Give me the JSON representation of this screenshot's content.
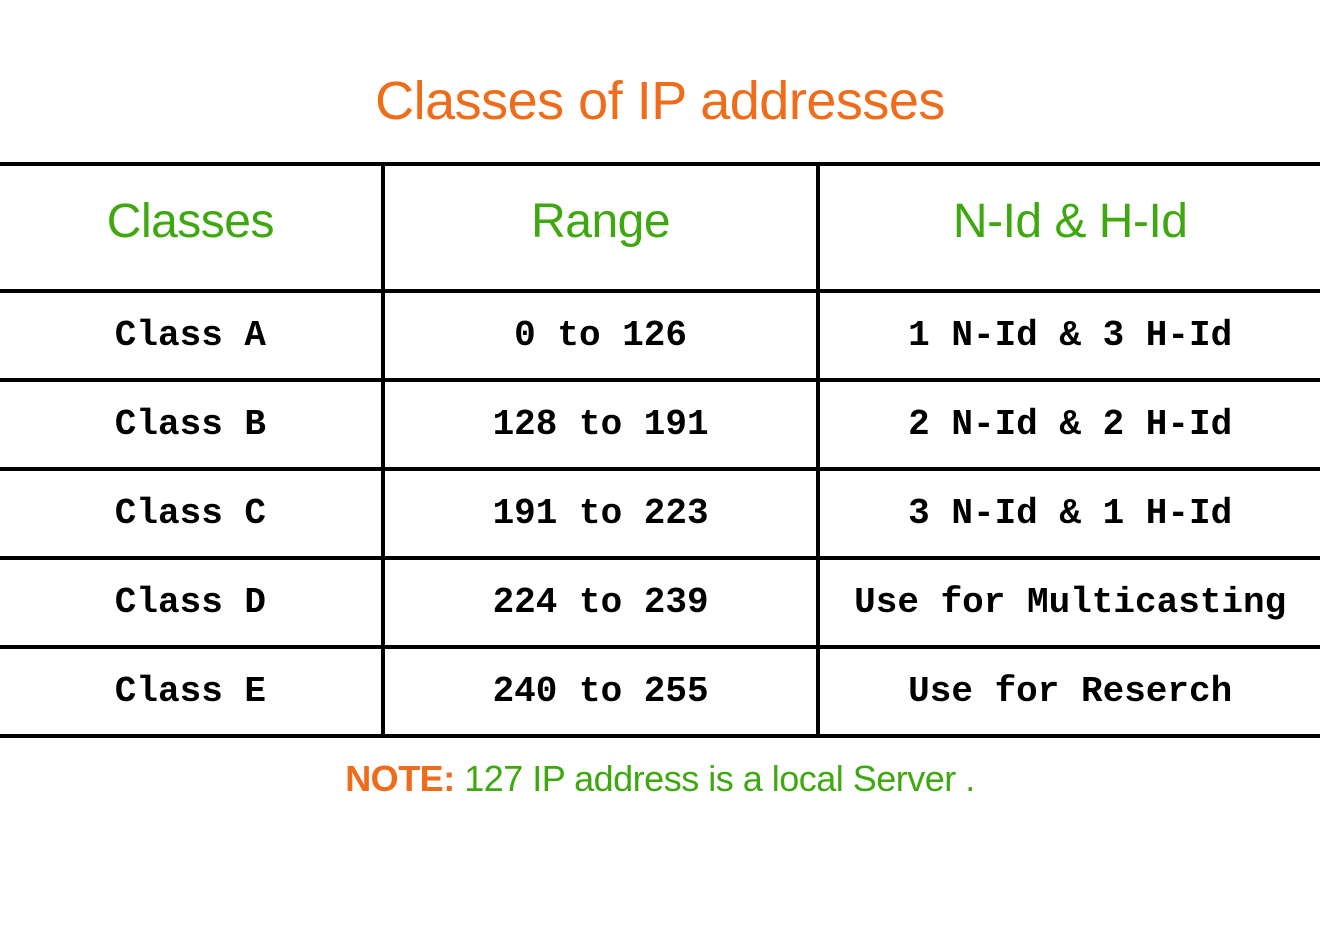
{
  "title": "Classes of IP addresses",
  "headers": {
    "col1": "Classes",
    "col2": "Range",
    "col3": "N-Id & H-Id"
  },
  "rows": [
    {
      "class": "Class A",
      "range": "0 to 126",
      "nid_hid": "1 N-Id & 3 H-Id"
    },
    {
      "class": "Class B",
      "range": "128 to 191",
      "nid_hid": "2 N-Id & 2 H-Id"
    },
    {
      "class": "Class C",
      "range": "191 to 223",
      "nid_hid": "3 N-Id & 1 H-Id"
    },
    {
      "class": "Class D",
      "range": "224 to 239",
      "nid_hid": "Use for Multicasting"
    },
    {
      "class": "Class E",
      "range": "240 to 255",
      "nid_hid": "Use for Reserch"
    }
  ],
  "note": {
    "label": "NOTE:",
    "text": " 127 IP address is a local Server ."
  },
  "chart_data": {
    "type": "table",
    "title": "Classes of IP addresses",
    "columns": [
      "Classes",
      "Range",
      "N-Id & H-Id"
    ],
    "data": [
      [
        "Class A",
        "0 to 126",
        "1 N-Id & 3 H-Id"
      ],
      [
        "Class B",
        "128 to 191",
        "2 N-Id & 2 H-Id"
      ],
      [
        "Class C",
        "191 to 223",
        "3 N-Id & 1 H-Id"
      ],
      [
        "Class D",
        "224 to 239",
        "Use for Multicasting"
      ],
      [
        "Class E",
        "240 to 255",
        "Use for Reserch"
      ]
    ],
    "note": "NOTE: 127 IP address is a local Server ."
  }
}
